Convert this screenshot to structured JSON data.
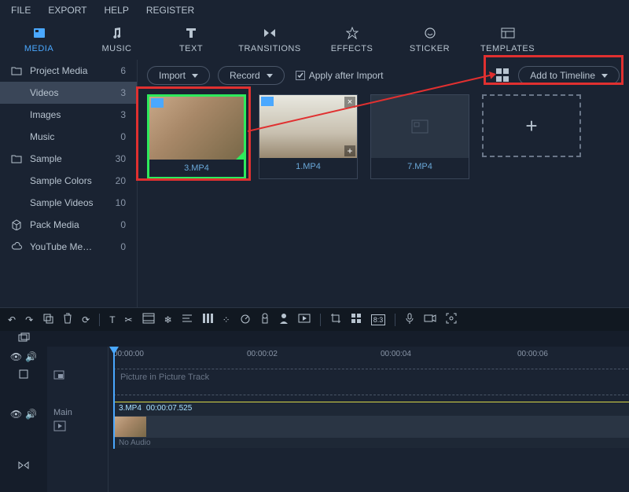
{
  "menu": {
    "file": "FILE",
    "export": "EXPORT",
    "help": "HELP",
    "register": "REGISTER"
  },
  "tabs": {
    "media": "MEDIA",
    "music": "MUSIC",
    "text": "TEXT",
    "transitions": "TRANSITIONS",
    "effects": "EFFECTS",
    "sticker": "STICKER",
    "templates": "TEMPLATES"
  },
  "sidebar": {
    "project": {
      "label": "Project Media",
      "count": "6"
    },
    "videos": {
      "label": "Videos",
      "count": "3"
    },
    "images": {
      "label": "Images",
      "count": "3"
    },
    "music": {
      "label": "Music",
      "count": "0"
    },
    "sample": {
      "label": "Sample",
      "count": "30"
    },
    "sample_colors": {
      "label": "Sample Colors",
      "count": "20"
    },
    "sample_videos": {
      "label": "Sample Videos",
      "count": "10"
    },
    "pack": {
      "label": "Pack Media",
      "count": "0"
    },
    "youtube": {
      "label": "YouTube Me…",
      "count": "0"
    }
  },
  "actions": {
    "import": "Import",
    "record": "Record",
    "apply": "Apply after Import",
    "add_timeline": "Add to Timeline"
  },
  "media_items": [
    {
      "name": "3.MP4",
      "selected": true
    },
    {
      "name": "1.MP4",
      "selected": false
    },
    {
      "name": "7.MP4",
      "selected": false
    }
  ],
  "timeline": {
    "t0": "00:00:00",
    "t1": "00:00:02",
    "t2": "00:00:04",
    "t3": "00:00:06",
    "pip_label": "Picture in Picture Track",
    "main_label": "Main",
    "clip_name": "3.MP4",
    "clip_dur": "00:00:07.525",
    "no_audio": "No Audio"
  }
}
